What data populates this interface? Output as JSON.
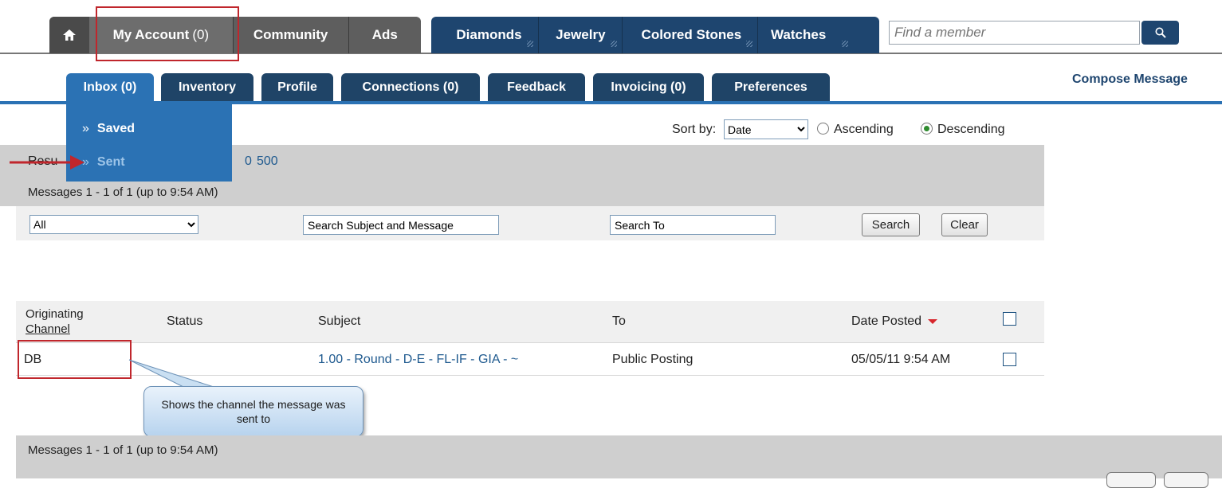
{
  "top_nav": {
    "home_icon": "home-icon",
    "my_account_label": "My Account",
    "my_account_count": "(0)",
    "community_label": "Community",
    "ads_label": "Ads",
    "diamonds_label": "Diamonds",
    "jewelry_label": "Jewelry",
    "colored_stones_label": "Colored Stones",
    "watches_label": "Watches",
    "search_placeholder": "Find a member",
    "search_icon": "search-icon"
  },
  "sub_tabs": [
    {
      "label": "Inbox (0)"
    },
    {
      "label": "Inventory"
    },
    {
      "label": "Profile"
    },
    {
      "label": "Connections (0)"
    },
    {
      "label": "Feedback"
    },
    {
      "label": "Invoicing (0)"
    },
    {
      "label": "Preferences"
    }
  ],
  "compose_label": "Compose Message",
  "inbox_menu": {
    "items": [
      {
        "label": "Saved"
      },
      {
        "label": "Sent"
      }
    ],
    "chevron": "»"
  },
  "sort": {
    "label": "Sort by:",
    "selected": "Date",
    "ascending_label": "Ascending",
    "descending_label": "Descending",
    "selected_order": "Descending"
  },
  "results": {
    "label_fragment": "Resu",
    "page_size_fragment": "0",
    "page_size_option": "500",
    "messages_range": "Messages 1 - 1 of 1 (up to 9:54 AM)"
  },
  "filters": {
    "channel_selected": "All",
    "subject_search": "Search Subject and Message",
    "to_search": "Search To",
    "search_button": "Search",
    "clear_button": "Clear"
  },
  "table": {
    "headers": {
      "channel_line1": "Originating",
      "channel_line2": "Channel",
      "status": "Status",
      "subject": "Subject",
      "to": "To",
      "date_posted": "Date Posted"
    },
    "rows": [
      {
        "channel": "DB",
        "status": "",
        "subject": "1.00 - Round - D-E - FL-IF - GIA - ~",
        "to": "Public Posting",
        "date_posted": "05/05/11 9:54 AM"
      }
    ]
  },
  "callout_text": "Shows the channel the message was sent to",
  "footer_range": "Messages 1 - 1 of 1 (up to 9:54 AM)",
  "colors": {
    "nav_dark": "#5e5e5e",
    "nav_blue": "#1e456f",
    "accent_blue": "#2b72b4",
    "highlight_red": "#c0262c"
  }
}
